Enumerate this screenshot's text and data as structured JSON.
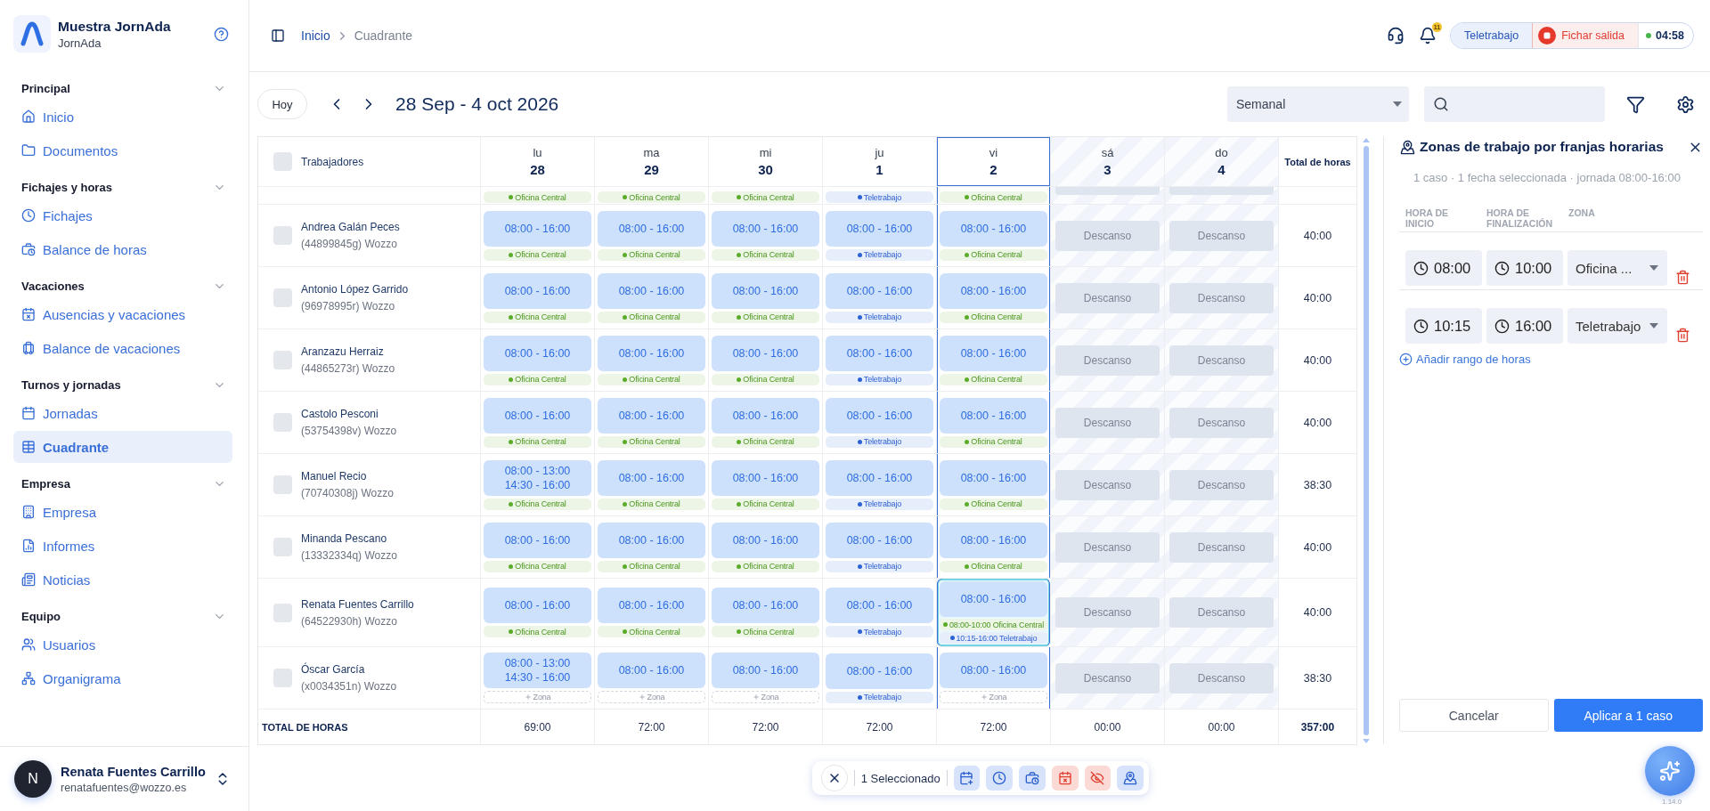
{
  "sidebar": {
    "brand": {
      "title": "Muestra JornAda",
      "subtitle": "JornAda"
    },
    "sections": [
      {
        "title": "Principal",
        "expanded": true,
        "items": [
          {
            "label": "Inicio",
            "selected": false
          },
          {
            "label": "Documentos",
            "selected": false
          }
        ]
      },
      {
        "title": "Fichajes y horas",
        "expanded": true,
        "items": [
          {
            "label": "Fichajes",
            "selected": false
          },
          {
            "label": "Balance de horas",
            "selected": false
          }
        ]
      },
      {
        "title": "Vacaciones",
        "expanded": true,
        "items": [
          {
            "label": "Ausencias y vacaciones",
            "selected": false
          },
          {
            "label": "Balance de vacaciones",
            "selected": false
          }
        ]
      },
      {
        "title": "Turnos y jornadas",
        "expanded": true,
        "items": [
          {
            "label": "Jornadas",
            "selected": false
          },
          {
            "label": "Cuadrante",
            "selected": true
          }
        ]
      },
      {
        "title": "Empresa",
        "expanded": true,
        "items": [
          {
            "label": "Empresa",
            "selected": false
          },
          {
            "label": "Informes",
            "selected": false
          },
          {
            "label": "Noticias",
            "selected": false
          }
        ]
      },
      {
        "title": "Equipo",
        "expanded": true,
        "items": [
          {
            "label": "Usuarios",
            "selected": false
          },
          {
            "label": "Organigrama",
            "selected": false
          }
        ]
      }
    ],
    "user": {
      "initial": "N",
      "name": "Renata Fuentes Carrillo",
      "email": "renatafuentes@wozzo.es"
    }
  },
  "topbar": {
    "breadcrumb": [
      {
        "label": "Inicio",
        "current": false
      },
      {
        "label": "Cuadrante",
        "current": true
      }
    ],
    "notifications": "11",
    "status": {
      "mode": "Teletrabajo",
      "clock_out": "Fichar salida",
      "timer": "04:58"
    }
  },
  "toolbar": {
    "today": "Hoy",
    "range": "28 Sep - 4 oct 2026",
    "view": "Semanal"
  },
  "schedule": {
    "workers_header": "Trabajadores",
    "all_checked": false,
    "total_header": "Total de horas",
    "days": [
      {
        "weekday": "lu",
        "day": "28",
        "kind": "workday",
        "selected": false
      },
      {
        "weekday": "ma",
        "day": "29",
        "kind": "workday",
        "selected": false
      },
      {
        "weekday": "mi",
        "day": "30",
        "kind": "workday",
        "selected": false
      },
      {
        "weekday": "ju",
        "day": "1",
        "kind": "workday",
        "selected": false
      },
      {
        "weekday": "vi",
        "day": "2",
        "kind": "workday",
        "selected": true
      },
      {
        "weekday": "sá",
        "day": "3",
        "kind": "weekend",
        "selected": false
      },
      {
        "weekday": "do",
        "day": "4",
        "kind": "weekend",
        "selected": false
      }
    ],
    "cut_row": {
      "cells": [
        {
          "kind": "shift",
          "selected": false,
          "zones": [
            {
              "kind": "office",
              "label": "Oficina Central"
            }
          ]
        },
        {
          "kind": "shift",
          "selected": false,
          "zones": [
            {
              "kind": "office",
              "label": "Oficina Central"
            }
          ]
        },
        {
          "kind": "shift",
          "selected": false,
          "zones": [
            {
              "kind": "office",
              "label": "Oficina Central"
            }
          ]
        },
        {
          "kind": "shift",
          "selected": false,
          "zones": [
            {
              "kind": "remote",
              "label": "Teletrabajo"
            }
          ]
        },
        {
          "kind": "shift",
          "selected": false,
          "zones": [
            {
              "kind": "office",
              "label": "Oficina Central"
            }
          ]
        },
        {
          "kind": "rest",
          "selected": false
        },
        {
          "kind": "rest",
          "selected": false
        }
      ]
    },
    "rows": [
      {
        "name": "Andrea Galán Peces",
        "detail": "(44899845g) Wozzo",
        "checked": false,
        "total": "40:00",
        "cells": [
          {
            "kind": "shift",
            "selected": false,
            "times": [
              "08:00 - 16:00"
            ],
            "zones": [
              {
                "kind": "office",
                "label": "Oficina Central"
              }
            ]
          },
          {
            "kind": "shift",
            "selected": false,
            "times": [
              "08:00 - 16:00"
            ],
            "zones": [
              {
                "kind": "office",
                "label": "Oficina Central"
              }
            ]
          },
          {
            "kind": "shift",
            "selected": false,
            "times": [
              "08:00 - 16:00"
            ],
            "zones": [
              {
                "kind": "office",
                "label": "Oficina Central"
              }
            ]
          },
          {
            "kind": "shift",
            "selected": false,
            "times": [
              "08:00 - 16:00"
            ],
            "zones": [
              {
                "kind": "remote",
                "label": "Teletrabajo"
              }
            ]
          },
          {
            "kind": "shift",
            "selected": false,
            "times": [
              "08:00 - 16:00"
            ],
            "zones": [
              {
                "kind": "office",
                "label": "Oficina Central"
              }
            ]
          },
          {
            "kind": "rest",
            "selected": false,
            "label": "Descanso"
          },
          {
            "kind": "rest",
            "selected": false,
            "label": "Descanso"
          }
        ]
      },
      {
        "name": "Antonio López Garrido",
        "detail": "(96978995r) Wozzo",
        "checked": false,
        "total": "40:00",
        "cells": [
          {
            "kind": "shift",
            "selected": false,
            "times": [
              "08:00 - 16:00"
            ],
            "zones": [
              {
                "kind": "office",
                "label": "Oficina Central"
              }
            ]
          },
          {
            "kind": "shift",
            "selected": false,
            "times": [
              "08:00 - 16:00"
            ],
            "zones": [
              {
                "kind": "office",
                "label": "Oficina Central"
              }
            ]
          },
          {
            "kind": "shift",
            "selected": false,
            "times": [
              "08:00 - 16:00"
            ],
            "zones": [
              {
                "kind": "office",
                "label": "Oficina Central"
              }
            ]
          },
          {
            "kind": "shift",
            "selected": false,
            "times": [
              "08:00 - 16:00"
            ],
            "zones": [
              {
                "kind": "remote",
                "label": "Teletrabajo"
              }
            ]
          },
          {
            "kind": "shift",
            "selected": false,
            "times": [
              "08:00 - 16:00"
            ],
            "zones": [
              {
                "kind": "office",
                "label": "Oficina Central"
              }
            ]
          },
          {
            "kind": "rest",
            "selected": false,
            "label": "Descanso"
          },
          {
            "kind": "rest",
            "selected": false,
            "label": "Descanso"
          }
        ]
      },
      {
        "name": "Aranzazu Herraiz",
        "detail": "(44865273r) Wozzo",
        "checked": false,
        "total": "40:00",
        "cells": [
          {
            "kind": "shift",
            "selected": false,
            "times": [
              "08:00 - 16:00"
            ],
            "zones": [
              {
                "kind": "office",
                "label": "Oficina Central"
              }
            ]
          },
          {
            "kind": "shift",
            "selected": false,
            "times": [
              "08:00 - 16:00"
            ],
            "zones": [
              {
                "kind": "office",
                "label": "Oficina Central"
              }
            ]
          },
          {
            "kind": "shift",
            "selected": false,
            "times": [
              "08:00 - 16:00"
            ],
            "zones": [
              {
                "kind": "office",
                "label": "Oficina Central"
              }
            ]
          },
          {
            "kind": "shift",
            "selected": false,
            "times": [
              "08:00 - 16:00"
            ],
            "zones": [
              {
                "kind": "remote",
                "label": "Teletrabajo"
              }
            ]
          },
          {
            "kind": "shift",
            "selected": false,
            "times": [
              "08:00 - 16:00"
            ],
            "zones": [
              {
                "kind": "office",
                "label": "Oficina Central"
              }
            ]
          },
          {
            "kind": "rest",
            "selected": false,
            "label": "Descanso"
          },
          {
            "kind": "rest",
            "selected": false,
            "label": "Descanso"
          }
        ]
      },
      {
        "name": "Castolo Pesconi",
        "detail": "(53754398v) Wozzo",
        "checked": false,
        "total": "40:00",
        "cells": [
          {
            "kind": "shift",
            "selected": false,
            "times": [
              "08:00 - 16:00"
            ],
            "zones": [
              {
                "kind": "office",
                "label": "Oficina Central"
              }
            ]
          },
          {
            "kind": "shift",
            "selected": false,
            "times": [
              "08:00 - 16:00"
            ],
            "zones": [
              {
                "kind": "office",
                "label": "Oficina Central"
              }
            ]
          },
          {
            "kind": "shift",
            "selected": false,
            "times": [
              "08:00 - 16:00"
            ],
            "zones": [
              {
                "kind": "office",
                "label": "Oficina Central"
              }
            ]
          },
          {
            "kind": "shift",
            "selected": false,
            "times": [
              "08:00 - 16:00"
            ],
            "zones": [
              {
                "kind": "remote",
                "label": "Teletrabajo"
              }
            ]
          },
          {
            "kind": "shift",
            "selected": false,
            "times": [
              "08:00 - 16:00"
            ],
            "zones": [
              {
                "kind": "office",
                "label": "Oficina Central"
              }
            ]
          },
          {
            "kind": "rest",
            "selected": false,
            "label": "Descanso"
          },
          {
            "kind": "rest",
            "selected": false,
            "label": "Descanso"
          }
        ]
      },
      {
        "name": "Manuel Recio",
        "detail": "(70740308j) Wozzo",
        "checked": false,
        "total": "38:30",
        "cells": [
          {
            "kind": "shift",
            "selected": false,
            "times": [
              "08:00 - 13:00",
              "14:30 - 16:00"
            ],
            "zones": [
              {
                "kind": "office",
                "label": "Oficina Central"
              }
            ]
          },
          {
            "kind": "shift",
            "selected": false,
            "times": [
              "08:00 - 16:00"
            ],
            "zones": [
              {
                "kind": "office",
                "label": "Oficina Central"
              }
            ]
          },
          {
            "kind": "shift",
            "selected": false,
            "times": [
              "08:00 - 16:00"
            ],
            "zones": [
              {
                "kind": "office",
                "label": "Oficina Central"
              }
            ]
          },
          {
            "kind": "shift",
            "selected": false,
            "times": [
              "08:00 - 16:00"
            ],
            "zones": [
              {
                "kind": "remote",
                "label": "Teletrabajo"
              }
            ]
          },
          {
            "kind": "shift",
            "selected": false,
            "times": [
              "08:00 - 16:00"
            ],
            "zones": [
              {
                "kind": "office",
                "label": "Oficina Central"
              }
            ]
          },
          {
            "kind": "rest",
            "selected": false,
            "label": "Descanso"
          },
          {
            "kind": "rest",
            "selected": false,
            "label": "Descanso"
          }
        ]
      },
      {
        "name": "Minanda Pescano",
        "detail": "(13332334q) Wozzo",
        "checked": false,
        "total": "40:00",
        "cells": [
          {
            "kind": "shift",
            "selected": false,
            "times": [
              "08:00 - 16:00"
            ],
            "zones": [
              {
                "kind": "office",
                "label": "Oficina Central"
              }
            ]
          },
          {
            "kind": "shift",
            "selected": false,
            "times": [
              "08:00 - 16:00"
            ],
            "zones": [
              {
                "kind": "office",
                "label": "Oficina Central"
              }
            ]
          },
          {
            "kind": "shift",
            "selected": false,
            "times": [
              "08:00 - 16:00"
            ],
            "zones": [
              {
                "kind": "office",
                "label": "Oficina Central"
              }
            ]
          },
          {
            "kind": "shift",
            "selected": false,
            "times": [
              "08:00 - 16:00"
            ],
            "zones": [
              {
                "kind": "remote",
                "label": "Teletrabajo"
              }
            ]
          },
          {
            "kind": "shift",
            "selected": false,
            "times": [
              "08:00 - 16:00"
            ],
            "zones": [
              {
                "kind": "office",
                "label": "Oficina Central"
              }
            ]
          },
          {
            "kind": "rest",
            "selected": false,
            "label": "Descanso"
          },
          {
            "kind": "rest",
            "selected": false,
            "label": "Descanso"
          }
        ]
      },
      {
        "name": "Renata Fuentes Carrillo",
        "detail": "(64522930h) Wozzo",
        "checked": false,
        "total": "40:00",
        "cells": [
          {
            "kind": "shift",
            "selected": false,
            "times": [
              "08:00 - 16:00"
            ],
            "zones": [
              {
                "kind": "office",
                "label": "Oficina Central"
              }
            ]
          },
          {
            "kind": "shift",
            "selected": false,
            "times": [
              "08:00 - 16:00"
            ],
            "zones": [
              {
                "kind": "office",
                "label": "Oficina Central"
              }
            ]
          },
          {
            "kind": "shift",
            "selected": false,
            "times": [
              "08:00 - 16:00"
            ],
            "zones": [
              {
                "kind": "office",
                "label": "Oficina Central"
              }
            ]
          },
          {
            "kind": "shift",
            "selected": false,
            "times": [
              "08:00 - 16:00"
            ],
            "zones": [
              {
                "kind": "remote",
                "label": "Teletrabajo"
              }
            ]
          },
          {
            "kind": "shift",
            "selected": true,
            "times": [
              "08:00 - 16:00"
            ],
            "zones": [
              {
                "kind": "office",
                "label": "08:00-10:00 Oficina Central"
              },
              {
                "kind": "remote",
                "label": "10:15-16:00 Teletrabajo"
              }
            ]
          },
          {
            "kind": "rest",
            "selected": false,
            "label": "Descanso"
          },
          {
            "kind": "rest",
            "selected": false,
            "label": "Descanso"
          }
        ]
      },
      {
        "name": "Óscar García",
        "detail": "(x0034351n) Wozzo",
        "checked": false,
        "total": "38:30",
        "cells": [
          {
            "kind": "shift",
            "selected": false,
            "times": [
              "08:00 - 13:00",
              "14:30 - 16:00"
            ],
            "zones": [
              {
                "kind": "add",
                "label": "Zona"
              }
            ]
          },
          {
            "kind": "shift",
            "selected": false,
            "times": [
              "08:00 - 16:00"
            ],
            "zones": [
              {
                "kind": "add",
                "label": "Zona"
              }
            ]
          },
          {
            "kind": "shift",
            "selected": false,
            "times": [
              "08:00 - 16:00"
            ],
            "zones": [
              {
                "kind": "add",
                "label": "Zona"
              }
            ]
          },
          {
            "kind": "shift",
            "selected": false,
            "times": [
              "08:00 - 16:00"
            ],
            "zones": [
              {
                "kind": "remote",
                "label": "Teletrabajo"
              }
            ]
          },
          {
            "kind": "shift",
            "selected": false,
            "times": [
              "08:00 - 16:00"
            ],
            "zones": [
              {
                "kind": "add",
                "label": "Zona"
              }
            ]
          },
          {
            "kind": "rest",
            "selected": false,
            "label": "Descanso"
          },
          {
            "kind": "rest",
            "selected": false,
            "label": "Descanso"
          }
        ]
      }
    ],
    "totals": {
      "label": "TOTAL DE HORAS",
      "values": [
        "69:00",
        "72:00",
        "72:00",
        "72:00",
        "72:00",
        "00:00",
        "00:00"
      ],
      "grand": "357:00"
    }
  },
  "zone_panel": {
    "title": "Zonas de trabajo por franjas horarias",
    "summary": "1 caso · 1 fecha seleccionada · jornada 08:00-16:00",
    "columns": [
      "HORA DE INICIO",
      "HORA DE FINALIZACIÓN",
      "ZONA"
    ],
    "ranges": [
      {
        "start": "08:00",
        "end": "10:00",
        "zone": "Oficina ..."
      },
      {
        "start": "10:15",
        "end": "16:00",
        "zone": "Teletrabajo"
      }
    ],
    "add": "Añadir rango de horas",
    "cancel": "Cancelar",
    "apply": "Aplicar a 1 caso"
  },
  "selection_bar": {
    "count": "1 Seleccionado"
  },
  "assistant": {
    "version": "1.14.0"
  }
}
